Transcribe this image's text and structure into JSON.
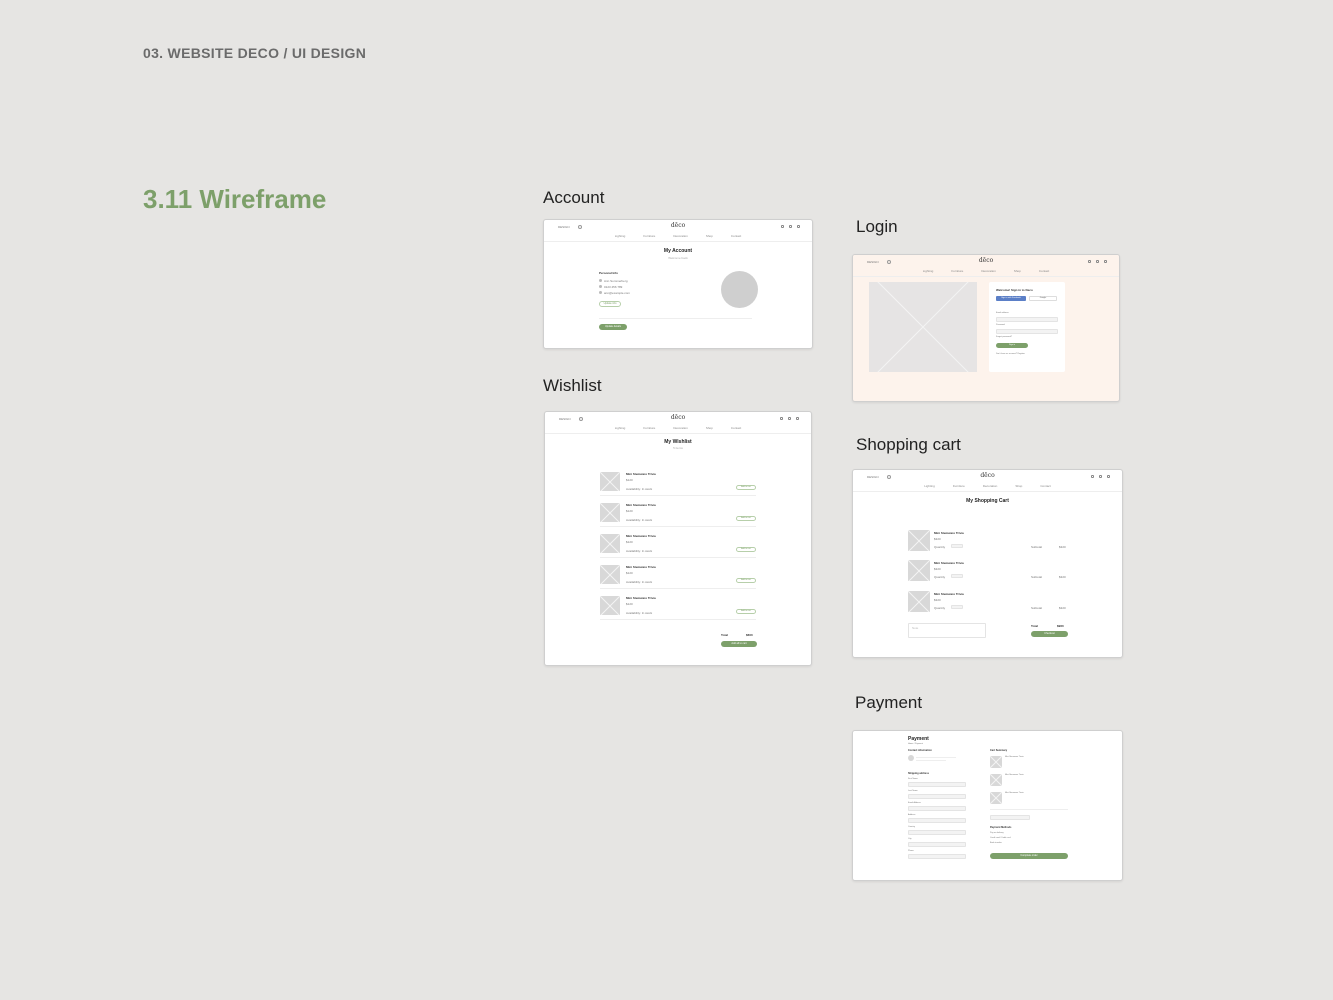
{
  "page": {
    "header": "03. WEBSITE DECO / UI DESIGN",
    "section_title": "3.11 Wireframe"
  },
  "nav": {
    "brand": "DESIGN",
    "logo": "dēco",
    "links": [
      "Lighting",
      "Furniture",
      "Decoration",
      "Shop",
      "Contact"
    ]
  },
  "frames": {
    "account": {
      "label": "Account",
      "title": "My Account",
      "subtitle": "Welcome back",
      "section": "Personal Info",
      "info_lines": [
        "Ann Sommerberg",
        "0123 456 789",
        "ann@example.com"
      ],
      "edit_button": "Update info",
      "main_button": "Update details"
    },
    "login": {
      "label": "Login",
      "heading": "Welcome! Sign in to Deco",
      "facebook": "Sign in with Facebook",
      "google": "Google",
      "email_label": "Email address",
      "password_label": "Password",
      "forgot": "Forgot password?",
      "button": "Sign in",
      "register": "Don't have an account? Register"
    },
    "wishlist": {
      "label": "Wishlist",
      "title": "My Wishlist",
      "subtitle": "5 items",
      "items": [
        {
          "name": "Mini Stemware Trivia",
          "price": "$120",
          "stock": "Availability: In stock",
          "button": "Add to cart"
        },
        {
          "name": "Mini Stemware Trivia",
          "price": "$120",
          "stock": "Availability: In stock",
          "button": "Add to cart"
        },
        {
          "name": "Mini Stemware Trivia",
          "price": "$120",
          "stock": "Availability: In stock",
          "button": "Add to cart"
        },
        {
          "name": "Mini Stemware Trivia",
          "price": "$120",
          "stock": "Availability: In stock",
          "button": "Add to cart"
        },
        {
          "name": "Mini Stemware Trivia",
          "price": "$120",
          "stock": "Availability: In stock",
          "button": "Add to cart"
        }
      ],
      "total_label": "Total",
      "total_value": "$600",
      "button": "Add all to cart"
    },
    "cart": {
      "label": "Shopping cart",
      "title": "My Shopping Cart",
      "items": [
        {
          "name": "Mini Stemware Trivia",
          "price": "$320",
          "qty_label": "Quantity",
          "subtotal_label": "Subtotal",
          "subtotal": "$320"
        },
        {
          "name": "Mini Stemware Trivia",
          "price": "$320",
          "qty_label": "Quantity",
          "subtotal_label": "Subtotal",
          "subtotal": "$320"
        },
        {
          "name": "Mini Stemware Trivia",
          "price": "$320",
          "qty_label": "Quantity",
          "subtotal_label": "Subtotal",
          "subtotal": "$320"
        }
      ],
      "note_placeholder": "Note",
      "total_label": "Total",
      "total_value": "$960",
      "button": "Checkout"
    },
    "payment": {
      "label": "Payment",
      "title": "Payment",
      "subtitle": "Home / Payment",
      "contact": "Contact information",
      "shipping": "Shipping address",
      "fields": [
        "First Name",
        "Last Name",
        "Email Address",
        "Address",
        "Country",
        "City",
        "Phone"
      ],
      "cart_summary": "Cart Summary",
      "summary_items": [
        "Mini Stemware Trivia",
        "Mini Stemware Trivia",
        "Mini Stemware Trivia"
      ],
      "payment_options": "Payment Methods",
      "options": [
        "Pay on delivery",
        "Credit card / Debit card",
        "Bank transfer"
      ],
      "button": "Complete order"
    }
  },
  "colors": {
    "background": "#e6e5e3",
    "accent": "#7da06a",
    "header_gray": "#6b6b6b",
    "login_bg": "#fdf3ec"
  }
}
